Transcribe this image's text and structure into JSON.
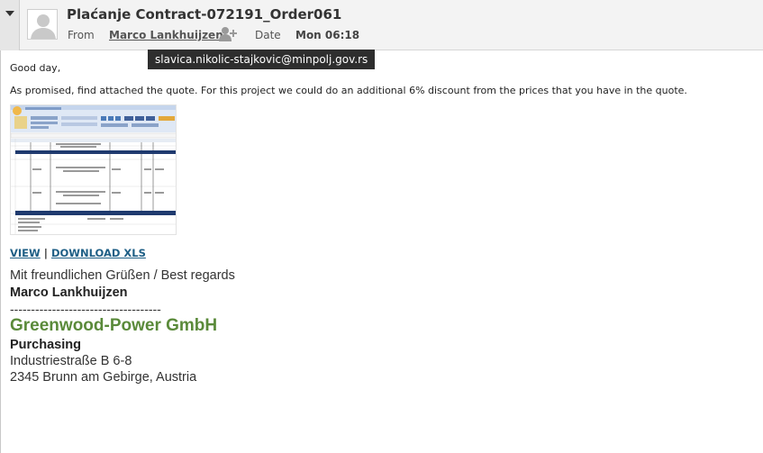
{
  "message": {
    "subject": "Plaćanje Contract-072191_Order061",
    "from_label": "From",
    "sender_name": "Marco Lankhuijzen",
    "date_label": "Date",
    "date_value": "Mon 06:18",
    "sender_email_tooltip": "slavica.nikolic-stajkovic@minpolj.gov.rs"
  },
  "body": {
    "greeting": "Good day,",
    "paragraph": "As promised, find attached the quote. For this project we could do an additional 6% discount from the prices that you have in the quote.",
    "attachment": {
      "view_label": "VIEW",
      "separator": "|",
      "download_label": "DOWNLOAD XLS"
    }
  },
  "signature": {
    "closing": "Mit freundlichen Grüßen / Best regards",
    "name": "Marco Lankhuijzen",
    "divider": "------------------------------------",
    "company": "Greenwood-Power GmbH",
    "department": "Purchasing",
    "street": "Industriestraße B 6-8",
    "city": "2345 Brunn am Gebirge, Austria"
  },
  "colors": {
    "link": "#1f5f86",
    "company": "#5a8a3a",
    "tooltip_bg": "#2e2e2e"
  },
  "icons": [
    "collapse-arrow-icon",
    "avatar-icon",
    "add-contact-icon"
  ]
}
